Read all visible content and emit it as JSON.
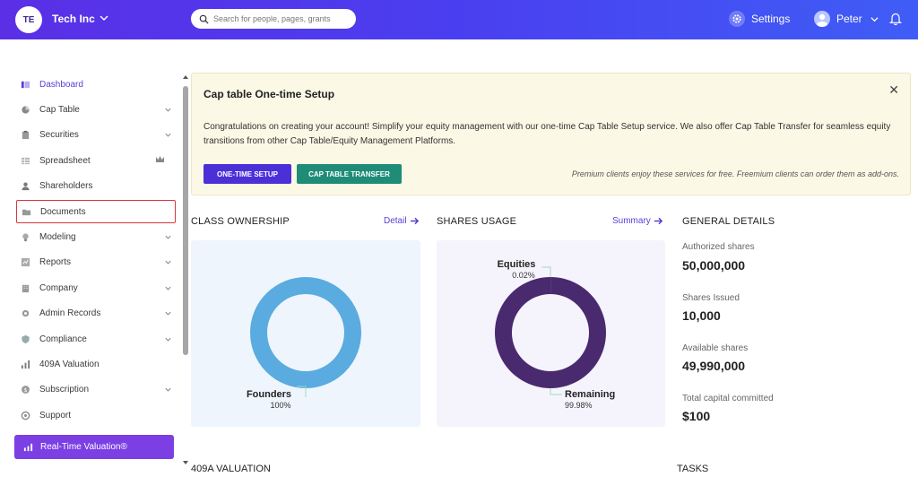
{
  "header": {
    "company_initials": "TE",
    "company_name": "Tech Inc",
    "search_placeholder": "Search for people, pages, grants",
    "settings_label": "Settings",
    "user_name": "Peter",
    "accent_gradient": [
      "#5a2fe6",
      "#3f5df6"
    ]
  },
  "sidebar": {
    "items": [
      {
        "label": "Dashboard",
        "icon": "dashboard-icon",
        "active": true,
        "chevron": false
      },
      {
        "label": "Cap Table",
        "icon": "pie-chart-icon",
        "chevron": true
      },
      {
        "label": "Securities",
        "icon": "clipboard-icon",
        "chevron": true
      },
      {
        "label": "Spreadsheet",
        "icon": "grid-icon",
        "chevron": false,
        "badge": "crown-icon"
      },
      {
        "label": "Shareholders",
        "icon": "person-icon",
        "chevron": false
      },
      {
        "label": "Documents",
        "icon": "folder-icon",
        "chevron": false,
        "highlighted": true
      },
      {
        "label": "Modeling",
        "icon": "bulb-icon",
        "chevron": true
      },
      {
        "label": "Reports",
        "icon": "chart-icon",
        "chevron": true
      },
      {
        "label": "Company",
        "icon": "building-icon",
        "chevron": true
      },
      {
        "label": "Admin Records",
        "icon": "gear-icon",
        "chevron": true
      },
      {
        "label": "Compliance",
        "icon": "shield-icon",
        "chevron": true
      },
      {
        "label": "409A Valuation",
        "icon": "bars-icon",
        "chevron": false
      },
      {
        "label": "Subscription",
        "icon": "dollar-icon",
        "chevron": true
      },
      {
        "label": "Support",
        "icon": "support-icon",
        "chevron": false
      }
    ],
    "cta_label": "Real-Time Valuation®",
    "cta_color": "#7b3fe4"
  },
  "banner": {
    "title": "Cap table One-time Setup",
    "close_glyph": "✕",
    "text": "Congratulations on creating your account! Simplify your equity management with our one-time Cap Table Setup service. We also offer Cap Table Transfer for seamless equity transitions from other Cap Table/Equity Management Platforms.",
    "primary_button": "ONE-TIME SETUP",
    "secondary_button": "CAP TABLE TRANSFER",
    "note": "Premium clients enjoy these services for free. Freemium clients can order them as add-ons."
  },
  "class_ownership": {
    "title": "CLASS OWNERSHIP",
    "link": "Detail",
    "color": "#5aabdf"
  },
  "shares_usage": {
    "title": "SHARES USAGE",
    "link": "Summary",
    "color": "#4a2a6e"
  },
  "chart_data": [
    {
      "type": "pie",
      "title": "CLASS OWNERSHIP",
      "categories": [
        "Founders"
      ],
      "values": [
        100
      ],
      "value_labels": [
        "100%"
      ],
      "colors": [
        "#5aabdf"
      ],
      "donut": true
    },
    {
      "type": "pie",
      "title": "SHARES USAGE",
      "categories": [
        "Equities",
        "Remaining"
      ],
      "values": [
        0.02,
        99.98
      ],
      "value_labels": [
        "0.02%",
        "99.98%"
      ],
      "colors": [
        "#c9b8e8",
        "#4a2a6e"
      ],
      "donut": true
    }
  ],
  "general_details": {
    "title": "GENERAL DETAILS",
    "items": [
      {
        "label": "Authorized shares",
        "value": "50,000,000"
      },
      {
        "label": "Shares Issued",
        "value": "10,000"
      },
      {
        "label": "Available shares",
        "value": "49,990,000"
      },
      {
        "label": "Total capital committed",
        "value": "$100"
      }
    ]
  },
  "bottom": {
    "left_title": "409A VALUATION",
    "right_title": "TASKS"
  }
}
